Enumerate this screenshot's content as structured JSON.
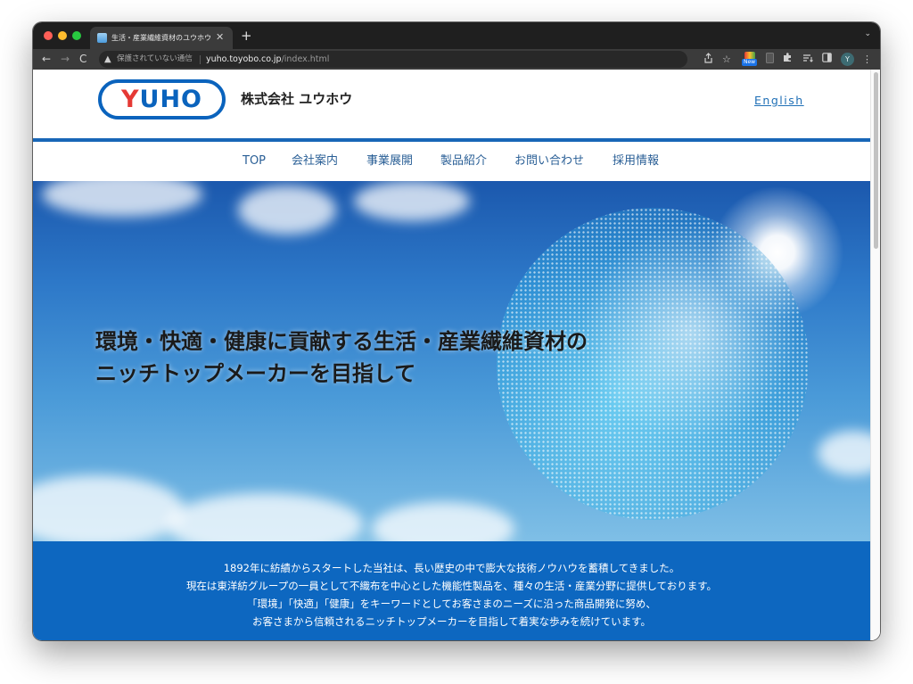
{
  "browser": {
    "tab_title": "生活・産業繊維資材のユウホウ | 東",
    "tab_close": "✕",
    "new_tab": "+",
    "tab_menu": "⌄",
    "nav_back": "←",
    "nav_forward": "→",
    "nav_reload": "C",
    "security_icon": "▲",
    "security_label": "保護されていない通信",
    "url_host": "yuho.toyobo.co.jp",
    "url_path": "/index.html",
    "extension_badge": "New",
    "profile_initial": "Y"
  },
  "header": {
    "logo_y": "Y",
    "logo_rest": "UHO",
    "company_name": "株式会社 ユウホウ",
    "language_link": "English"
  },
  "nav": {
    "items": [
      "TOP",
      "会社案内",
      "事業展開",
      "製品紹介",
      "お問い合わせ",
      "採用情報"
    ]
  },
  "hero": {
    "headline_line1": "環境・快適・健康に貢献する生活・産業繊維資材の",
    "headline_line2": "ニッチトップメーカーを目指して"
  },
  "intro": {
    "lines": [
      "1892年に紡績からスタートした当社は、長い歴史の中で膨大な技術ノウハウを蓄積してきました。",
      "現在は東洋紡グループの一員として不織布を中心とした機能性製品を、種々の生活・産業分野に提供しております。",
      "「環境」「快適」「健康」をキーワードとしてお客さまのニーズに沿った商品開発に努め、",
      "お客さまから信頼されるニッチトップメーカーを目指して着実な歩みを続けています。"
    ]
  },
  "colors": {
    "brand_blue": "#0a63bd",
    "logo_red": "#e53935",
    "nav_text": "#2a5f96",
    "intro_band": "#0d67c0"
  }
}
